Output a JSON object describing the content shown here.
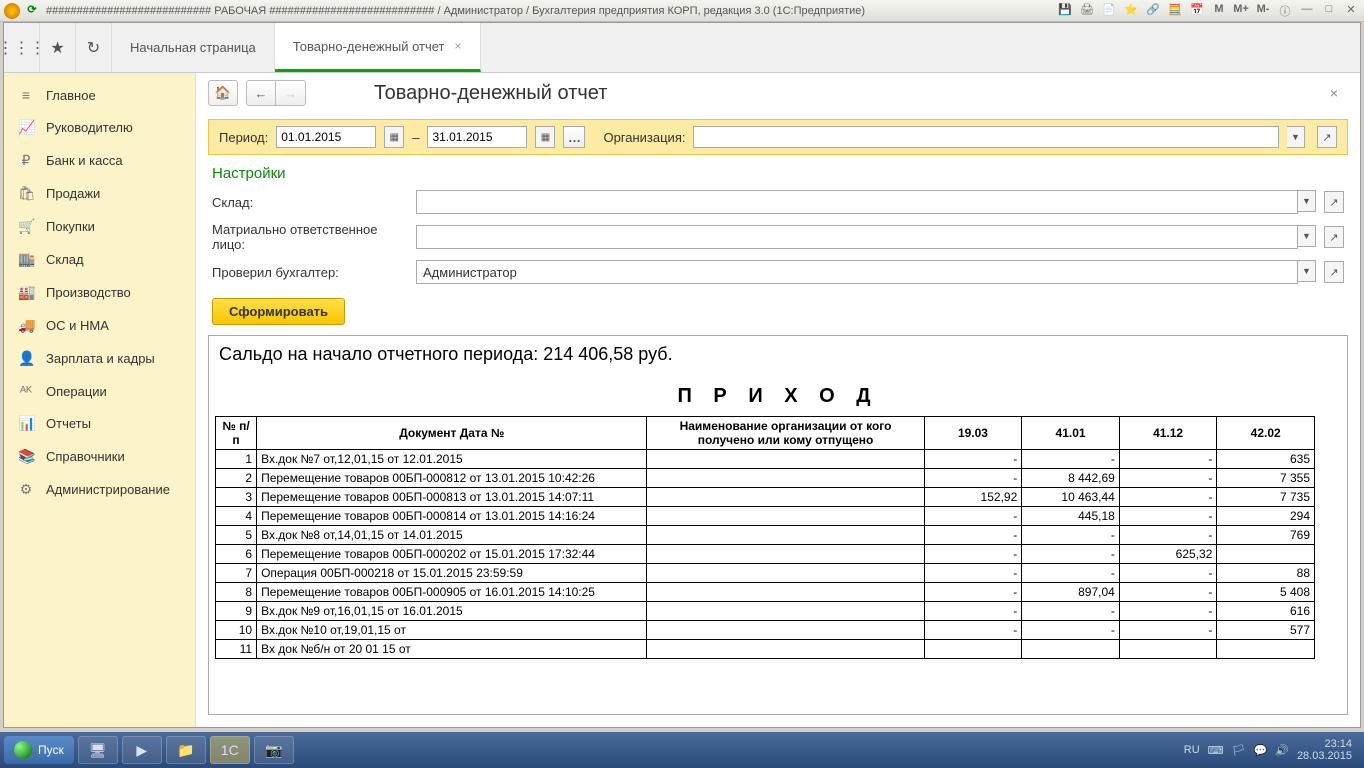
{
  "window": {
    "title": "########################### РАБОЧАЯ ########################### / Администратор / Бухгалтерия предприятия КОРП, редакция 3.0  (1С:Предприятие)",
    "m_buttons": [
      "M",
      "M+",
      "M-"
    ]
  },
  "tabs": {
    "home": "Начальная страница",
    "active": "Товарно-денежный отчет"
  },
  "sidebar": {
    "items": [
      {
        "icon": "≡",
        "label": "Главное"
      },
      {
        "icon": "📈",
        "label": "Руководителю"
      },
      {
        "icon": "₽",
        "label": "Банк и касса"
      },
      {
        "icon": "🛍",
        "label": "Продажи"
      },
      {
        "icon": "🛒",
        "label": "Покупки"
      },
      {
        "icon": "🏬",
        "label": "Склад"
      },
      {
        "icon": "🏭",
        "label": "Производство"
      },
      {
        "icon": "🚚",
        "label": "ОС и НМА"
      },
      {
        "icon": "👤",
        "label": "Зарплата и кадры"
      },
      {
        "icon": "ᴬᴷ",
        "label": "Операции"
      },
      {
        "icon": "📊",
        "label": "Отчеты"
      },
      {
        "icon": "📚",
        "label": "Справочники"
      },
      {
        "icon": "⚙",
        "label": "Администрирование"
      }
    ]
  },
  "page": {
    "title": "Товарно-денежный отчет",
    "period_label": "Период:",
    "date_from": "01.01.2015",
    "date_to": "31.01.2015",
    "dash": "–",
    "org_label": "Организация:",
    "org_value": "",
    "settings_title": "Настройки",
    "warehouse_label": "Склад:",
    "warehouse_value": "",
    "mol_label": "Матриально ответственное лицо:",
    "mol_value": "",
    "accountant_label": "Проверил бухгалтер:",
    "accountant_value": "Администратор",
    "form_btn": "Сформировать"
  },
  "report": {
    "saldo": "Сальдо на начало отчетного периода: 214 406,58 руб.",
    "section_title": "П Р И Х О Д",
    "headers": {
      "num": "№ п/п",
      "doc": "Документ Дата №",
      "org": "Наименование организации от кого получено или кому отпущено",
      "c1": "19.03",
      "c2": "41.01",
      "c3": "41.12",
      "c4": "42.02"
    },
    "rows": [
      {
        "n": "1",
        "doc": "Вх.док №7 от,12,01,15           от 12.01.2015",
        "org": "",
        "v1": "-",
        "v2": "-",
        "v3": "-",
        "v4": "635"
      },
      {
        "n": "2",
        "doc": "Перемещение товаров 00БП-000812 от 13.01.2015 10:42:26",
        "org": "",
        "v1": "-",
        "v2": "8 442,69",
        "v3": "-",
        "v4": "7 355"
      },
      {
        "n": "3",
        "doc": "Перемещение товаров 00БП-000813 от 13.01.2015 14:07:11",
        "org": "",
        "v1": "152,92",
        "v2": "10 463,44",
        "v3": "-",
        "v4": "7 735"
      },
      {
        "n": "4",
        "doc": "Перемещение товаров 00БП-000814 от 13.01.2015 14:16:24",
        "org": "",
        "v1": "-",
        "v2": "445,18",
        "v3": "-",
        "v4": "294"
      },
      {
        "n": "5",
        "doc": "Вх.док №8 от,14,01,15           от 14.01.2015",
        "org": "",
        "v1": "-",
        "v2": "-",
        "v3": "-",
        "v4": "769"
      },
      {
        "n": "6",
        "doc": "Перемещение товаров 00БП-000202 от 15.01.2015 17:32:44",
        "org": "",
        "v1": "-",
        "v2": "-",
        "v3": "625,32",
        "v4": ""
      },
      {
        "n": "7",
        "doc": "Операция 00БП-000218 от 15.01.2015 23:59:59",
        "org": "",
        "v1": "-",
        "v2": "-",
        "v3": "-",
        "v4": "88"
      },
      {
        "n": "8",
        "doc": "Перемещение товаров 00БП-000905 от 16.01.2015 14:10:25",
        "org": "",
        "v1": "-",
        "v2": "897,04",
        "v3": "-",
        "v4": "5 408"
      },
      {
        "n": "9",
        "doc": "Вх.док №9 от,16,01,15           от 16.01.2015",
        "org": "",
        "v1": "-",
        "v2": "-",
        "v3": "-",
        "v4": "616"
      },
      {
        "n": "10",
        "doc": "Вх.док №10 от,19,01,15           от",
        "org": "",
        "v1": "-",
        "v2": "-",
        "v3": "-",
        "v4": "577"
      },
      {
        "n": "11",
        "doc": "Вх док №б/н от 20 01 15           от",
        "org": "",
        "v1": "",
        "v2": "",
        "v3": "",
        "v4": ""
      }
    ]
  },
  "taskbar": {
    "start": "Пуск",
    "lang": "RU",
    "time": "23:14",
    "date": "28.03.2015"
  }
}
